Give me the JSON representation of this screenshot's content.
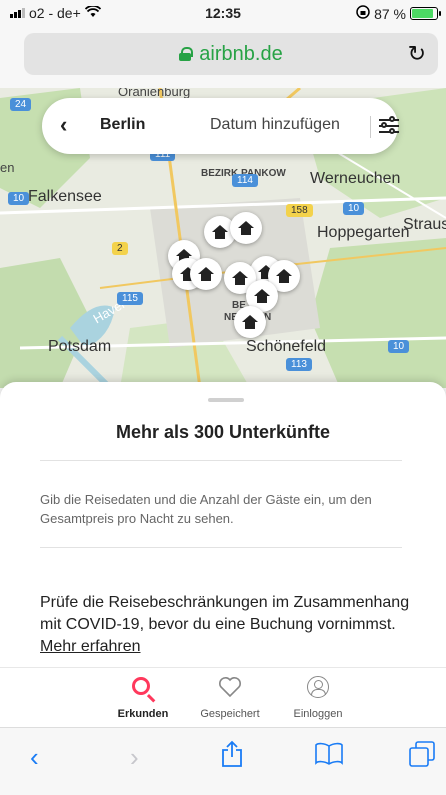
{
  "status_bar": {
    "carrier": "o2 - de+",
    "time": "12:35",
    "battery": "87 %"
  },
  "browser": {
    "url": "airbnb.de"
  },
  "search": {
    "location": "Berlin",
    "date_placeholder": "Datum hinzufügen"
  },
  "map": {
    "labels": [
      "Oranienburg",
      "Werneuchen",
      "BEZIRK PANKOW",
      "Falkensee",
      "Strausb",
      "Hoppegarten",
      "Havel",
      "Potsdam",
      "Schönefeld",
      "BE",
      "N",
      "NE",
      "en"
    ],
    "road_numbers": [
      "24",
      "111",
      "114",
      "10",
      "158",
      "10",
      "2",
      "115",
      "10",
      "113"
    ]
  },
  "sheet": {
    "title": "Mehr als 300 Unterkünfte",
    "hint": "Gib die Reisedaten und die Anzahl der Gäste ein, um den Gesamtpreis pro Nacht zu sehen.",
    "covid_text": "Prüfe die Reisebeschränkungen im Zusammenhang mit COVID-19, bevor du eine Buchung vornimmst.",
    "covid_link": "Mehr erfahren"
  },
  "tabs": [
    {
      "label": "Erkunden",
      "icon": "search-icon",
      "active": true
    },
    {
      "label": "Gespeichert",
      "icon": "heart-icon",
      "active": false
    },
    {
      "label": "Einloggen",
      "icon": "user-icon",
      "active": false
    }
  ],
  "colors": {
    "accent": "#ff385c",
    "url_green": "#27a245",
    "safari_blue": "#1a7cf5"
  }
}
